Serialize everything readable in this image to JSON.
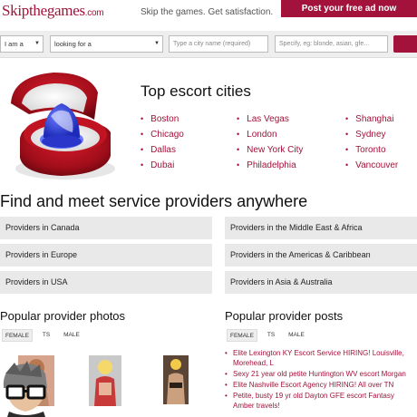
{
  "header": {
    "logo_main": "Skipthegames",
    "logo_suffix": ".com",
    "tagline": "Skip the games. Get satisfaction.",
    "post_ad_label": "Post your free ad now",
    "accent_color": "#a3123a"
  },
  "search": {
    "iam_value": "I am a",
    "lookingfor_value": "looking for a",
    "city_placeholder": "Type a city name (required)",
    "specify_placeholder": "Specify, eg: blonde, asian, gfe..."
  },
  "hero": {
    "title": "Top escort cities",
    "cities": [
      [
        "Boston",
        "Chicago",
        "Dallas",
        "Dubai"
      ],
      [
        "Las Vegas",
        "London",
        "New York City",
        "Philadelphia"
      ],
      [
        "Shanghai",
        "Sydney",
        "Toronto",
        "Vancouver"
      ]
    ]
  },
  "find": {
    "title": "Find and meet service providers anywhere",
    "left": [
      "Providers in Canada",
      "Providers in Europe",
      "Providers in USA"
    ],
    "right": [
      "Providers in the Middle East & Africa",
      "Providers in the Americas & Caribbean",
      "Providers in Asia & Australia"
    ]
  },
  "photos": {
    "title": "Popular provider photos",
    "tabs": [
      "FEMALE",
      "TS",
      "MALE"
    ]
  },
  "posts": {
    "title": "Popular provider posts",
    "tabs": [
      "FEMALE",
      "TS",
      "MALE"
    ],
    "items": [
      "Elite Lexington KY Escort Service HIRING! Louisville, Morehead, L",
      "Sexy 21 year old petite Huntington WV escort Morgan",
      "Elite Nashville Escort Agency HIRING! All over TN",
      "Petite, busty 19 yr old Dayton GFE escort Fantasy Amber travels!"
    ]
  }
}
